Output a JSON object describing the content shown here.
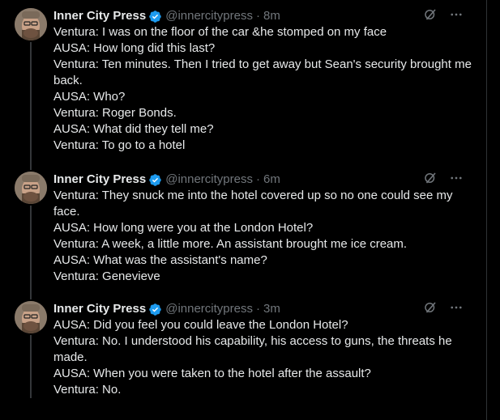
{
  "colors": {
    "background": "#000000",
    "text": "#e7e9ea",
    "muted": "#71767b",
    "verified": "#1d9bf0",
    "thread_line": "#333639"
  },
  "tweets": [
    {
      "name": "Inner City Press",
      "handle": "@innercitypress",
      "separator": "·",
      "time": "8m",
      "verified_icon": "verified-badge-icon",
      "lines": [
        "Ventura: I was on the floor of the car &he stomped on my face",
        "AUSA: How long did this last?",
        "Ventura: Ten minutes. Then I tried to get away but Sean's security brought me back.",
        "AUSA: Who?",
        "Ventura: Roger Bonds.",
        "AUSA: What did they tell me?",
        "Ventura: To go to a hotel"
      ]
    },
    {
      "name": "Inner City Press",
      "handle": "@innercitypress",
      "separator": "·",
      "time": "6m",
      "verified_icon": "verified-badge-icon",
      "lines": [
        "Ventura: They snuck me into the hotel covered up so no one could see my face.",
        "AUSA: How long were you at the London Hotel?",
        "Ventura: A week, a little more.  An assistant brought me ice cream.",
        "AUSA: What was the assistant's name?",
        "Ventura: Genevieve"
      ]
    },
    {
      "name": "Inner City Press",
      "handle": "@innercitypress",
      "separator": "·",
      "time": "3m",
      "verified_icon": "verified-badge-icon",
      "lines": [
        "AUSA: Did you feel you could leave the London Hotel?",
        "Ventura: No. I understood his capability, his access to guns, the threats he made.",
        "AUSA: When you were taken to the hotel after the assault?",
        "Ventura: No."
      ]
    }
  ],
  "icons": {
    "grok": "grok-icon",
    "more": "more-options-icon"
  }
}
